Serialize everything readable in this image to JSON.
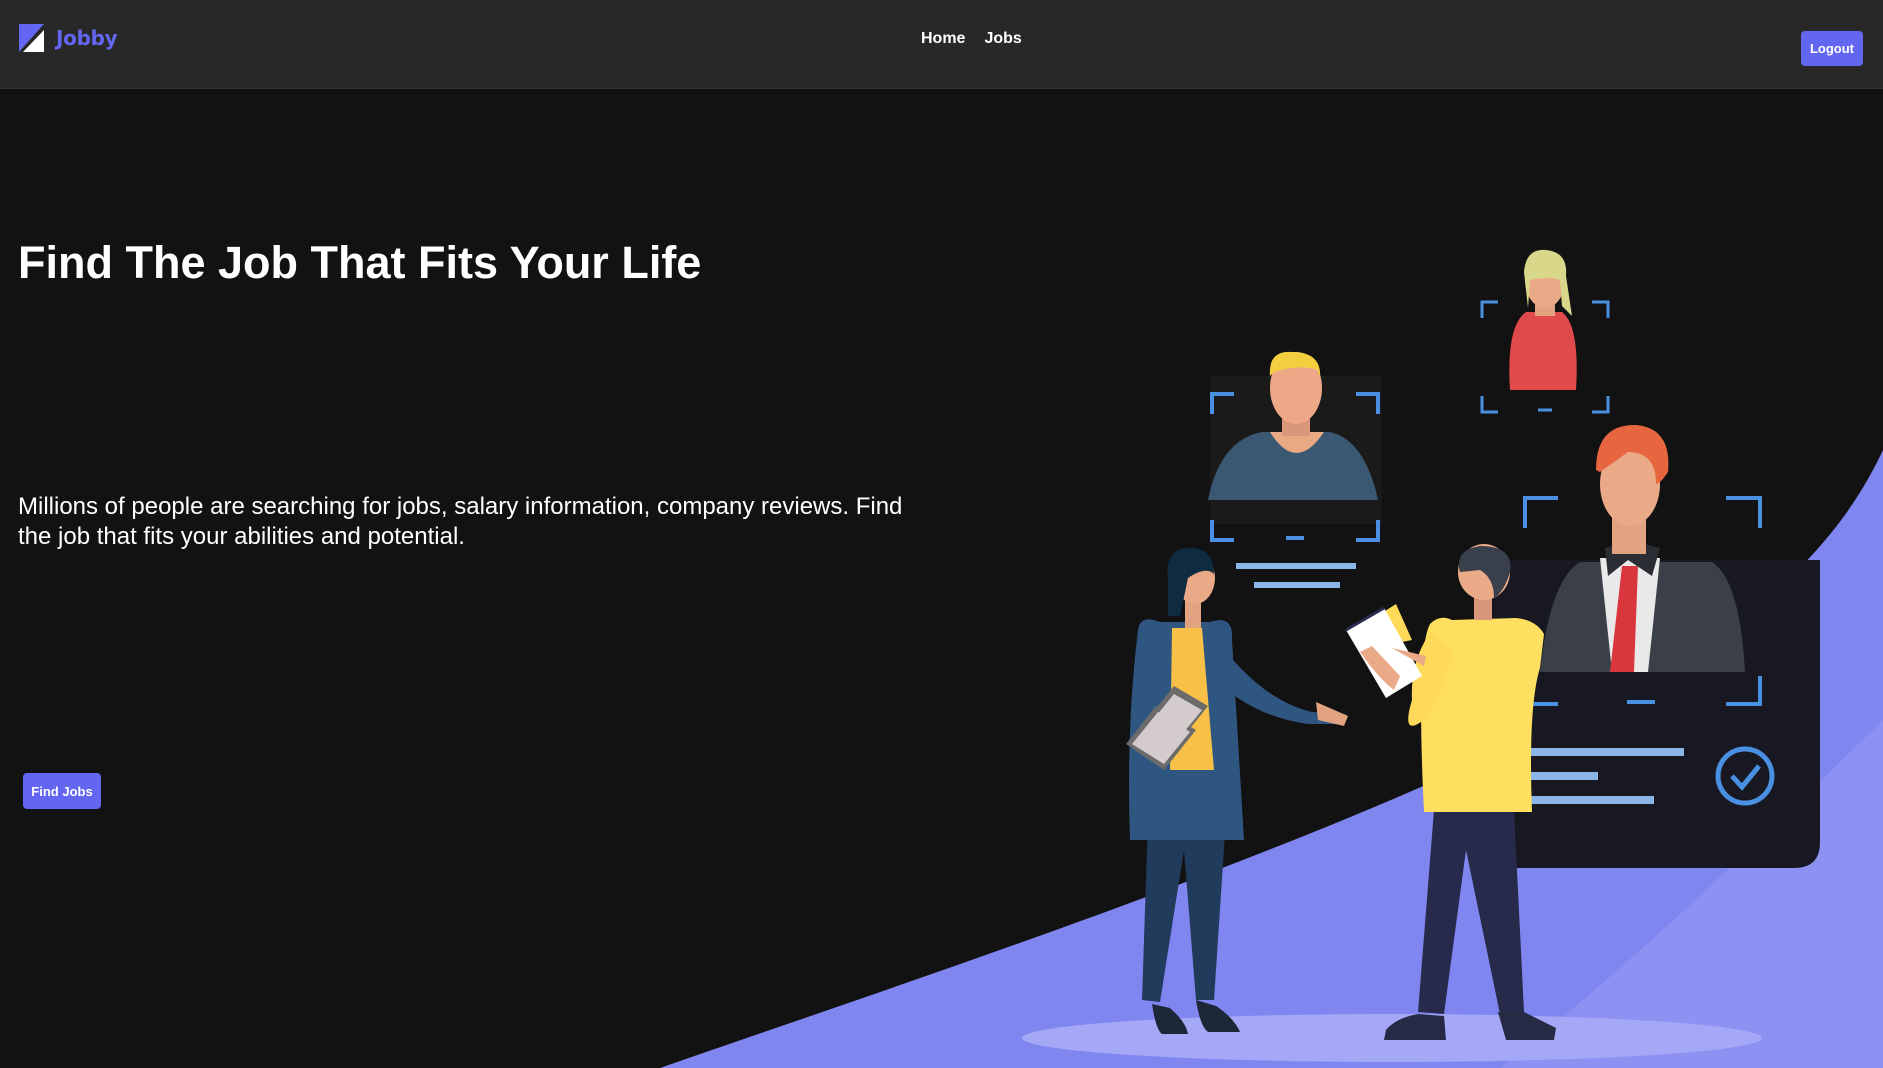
{
  "brand": {
    "name": "Jobby",
    "icon": "jobby-logo-icon",
    "color": "#6366f1"
  },
  "nav": {
    "links": [
      {
        "label": "Home"
      },
      {
        "label": "Jobs"
      }
    ],
    "logout_label": "Logout"
  },
  "hero": {
    "title": "Find The Job That Fits Your Life",
    "description": "Millions of people are searching for jobs, salary information, company reviews. Find the job that fits your abilities and potential.",
    "cta_label": "Find Jobs",
    "illustration": "job-interview-illustration"
  },
  "colors": {
    "background": "#121212",
    "navbar": "#282828",
    "accent": "#6366f1",
    "hill": "#8086f0"
  }
}
